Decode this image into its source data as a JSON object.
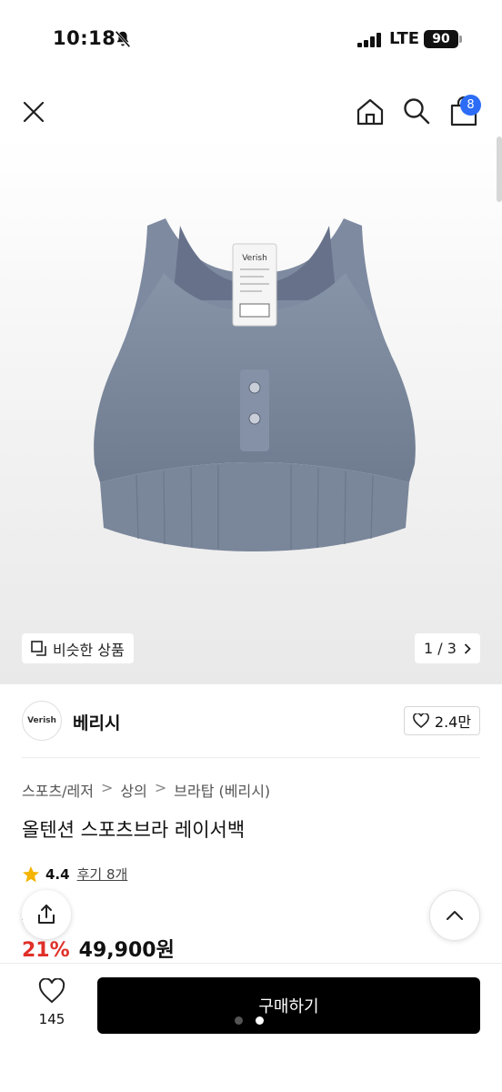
{
  "status_bar": {
    "time": "10:18",
    "network": "LTE",
    "battery": "90"
  },
  "nav": {
    "cart_count": "8"
  },
  "gallery": {
    "similar_label": "비슷한 상품",
    "page": "1 / 3"
  },
  "brand": {
    "logo_text": "Verish",
    "name": "베리시",
    "likes": "2.4만"
  },
  "breadcrumb": [
    "스포츠/레저",
    "상의",
    "브라탑 (베리시)"
  ],
  "product": {
    "title": "올텐션 스포츠브라 레이서백",
    "rating": "4.4",
    "review_label": "후기 8개",
    "original_price": "9원",
    "discount": "21%",
    "price": "49,900원"
  },
  "bottom_bar": {
    "wish_count": "145",
    "buy_label": "구매하기"
  },
  "colors": {
    "accent_blue": "#2c6cf6",
    "discount_red": "#e0312a",
    "star": "#f5b400"
  }
}
